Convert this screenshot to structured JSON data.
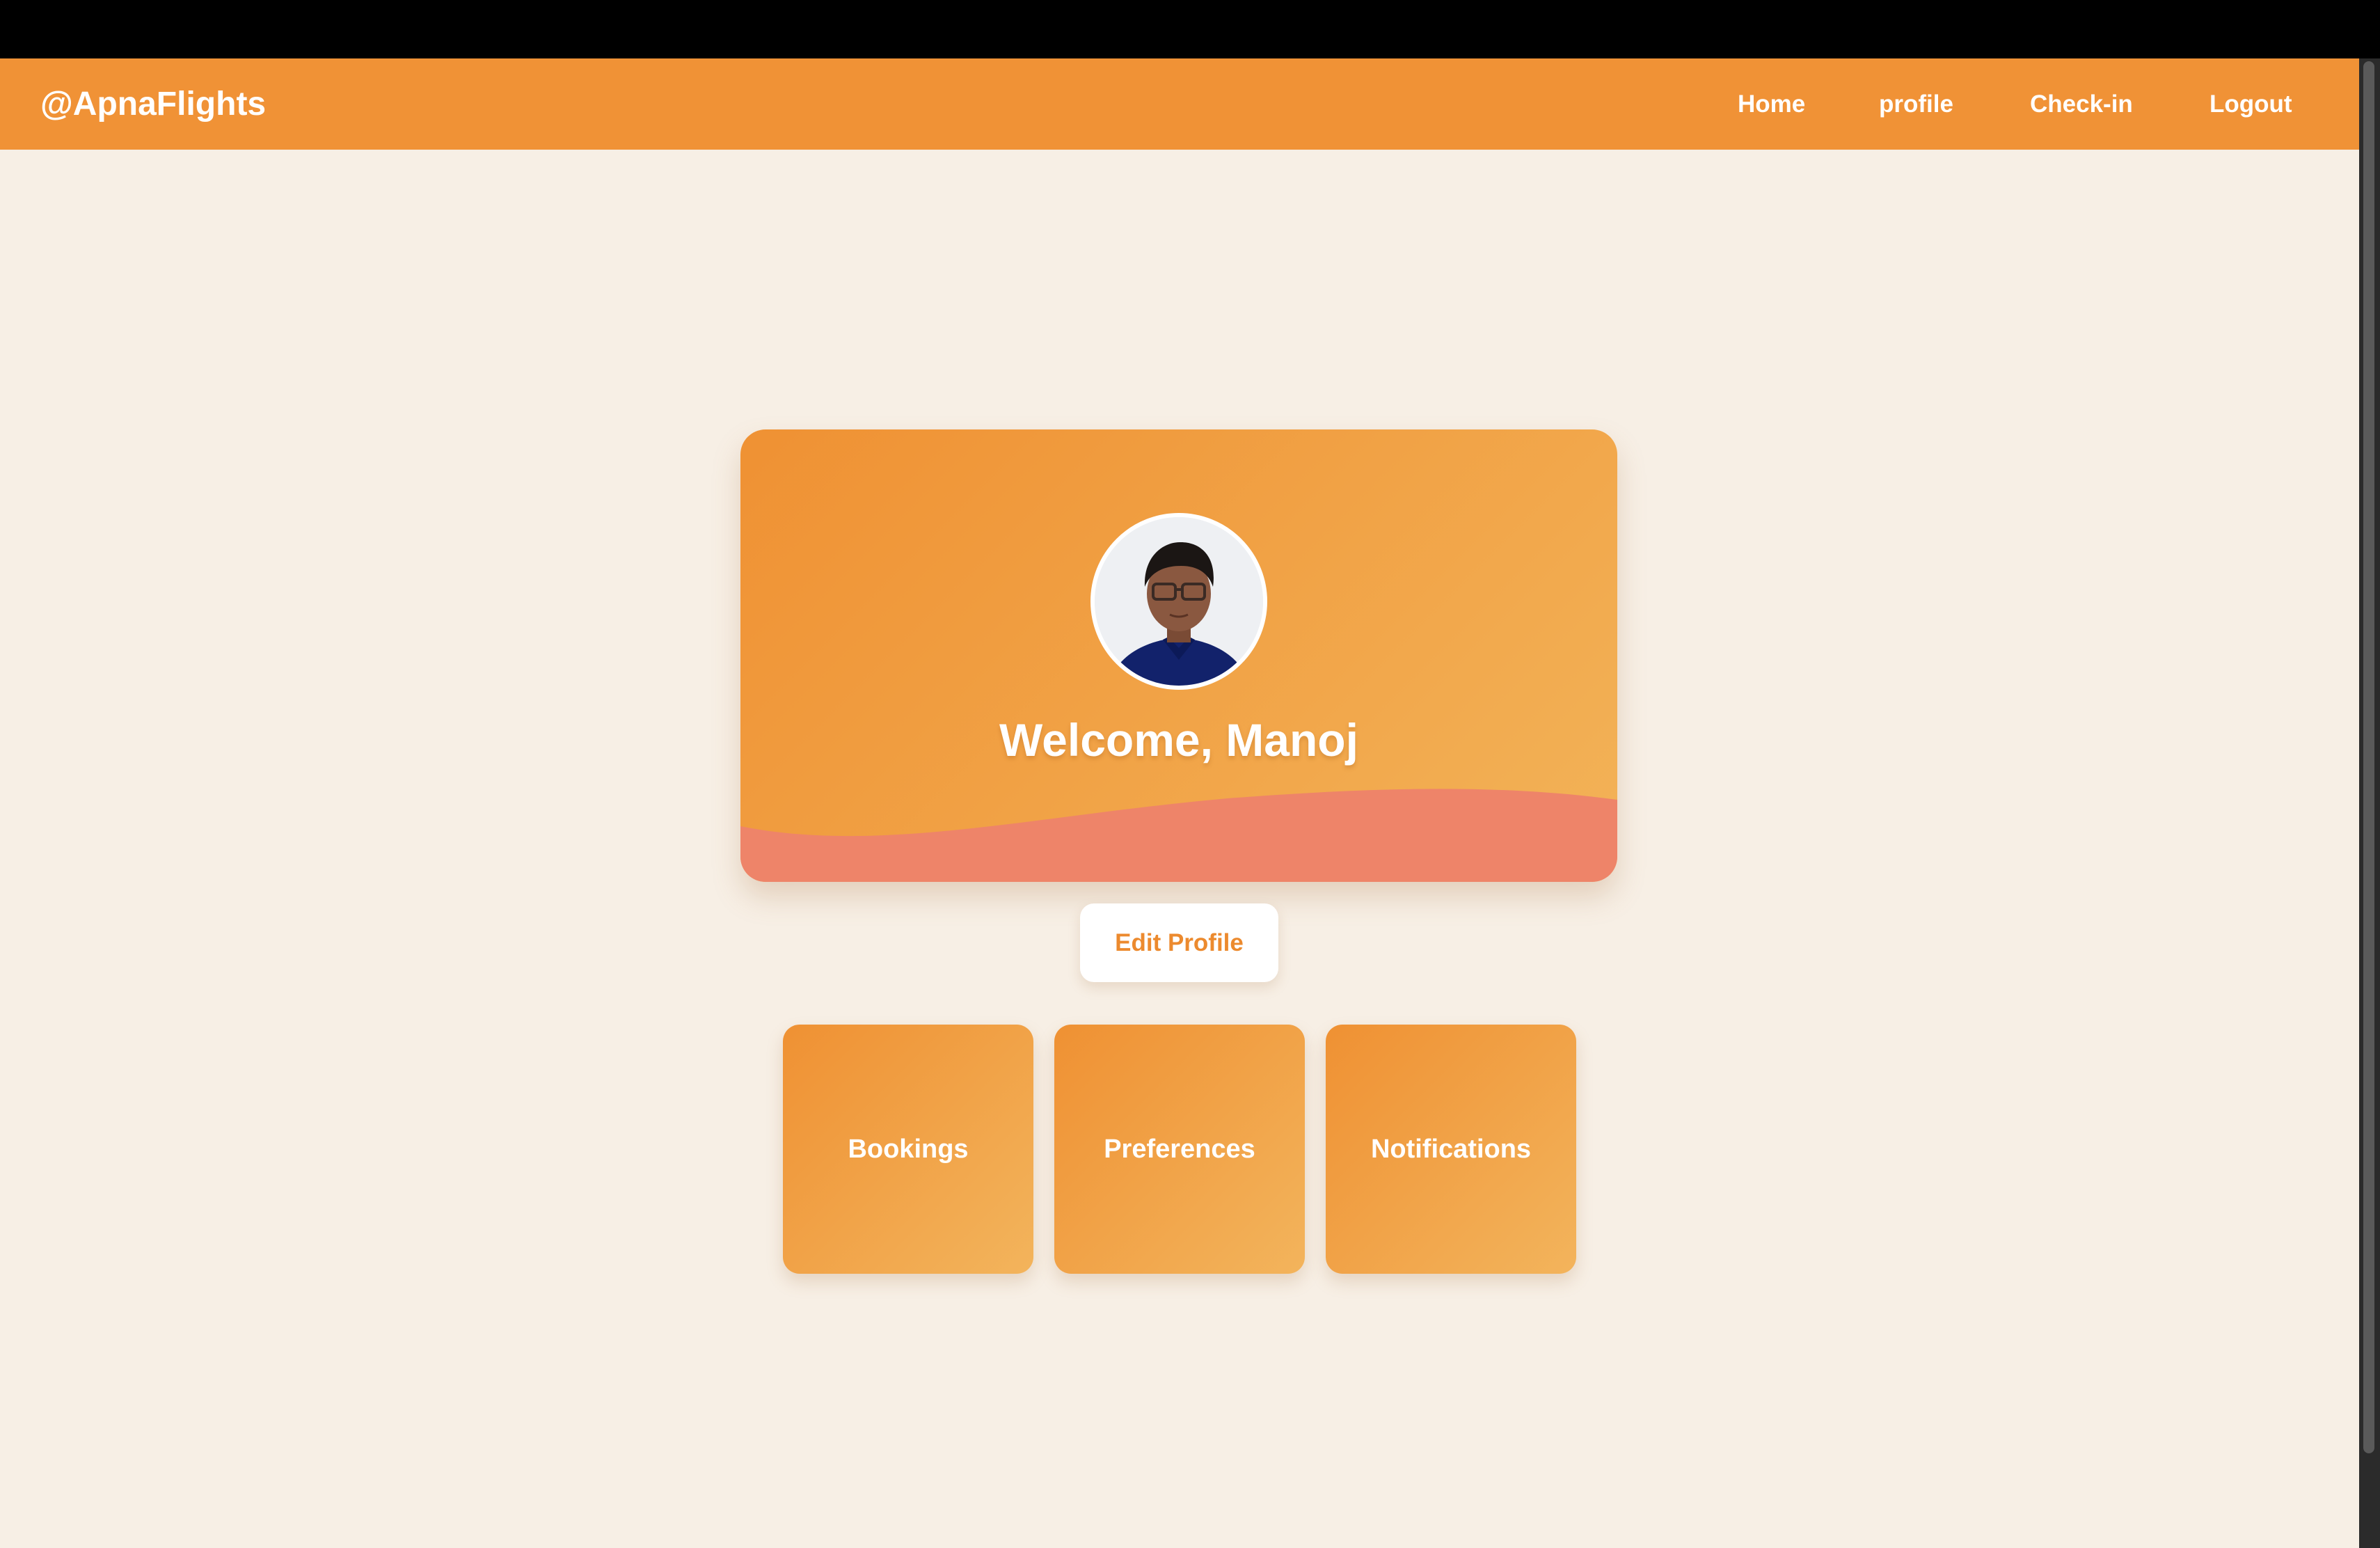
{
  "navbar": {
    "brand": "@ApnaFlights",
    "links": [
      {
        "label": "Home"
      },
      {
        "label": "profile"
      },
      {
        "label": "Check-in"
      },
      {
        "label": "Logout"
      }
    ]
  },
  "profile": {
    "welcome": "Welcome, Manoj",
    "edit_label": "Edit Profile"
  },
  "tiles": [
    {
      "label": "Bookings"
    },
    {
      "label": "Preferences"
    },
    {
      "label": "Notifications"
    }
  ],
  "colors": {
    "accent": "#f09236",
    "background": "#f7efe5",
    "wave": "#ee8469"
  }
}
